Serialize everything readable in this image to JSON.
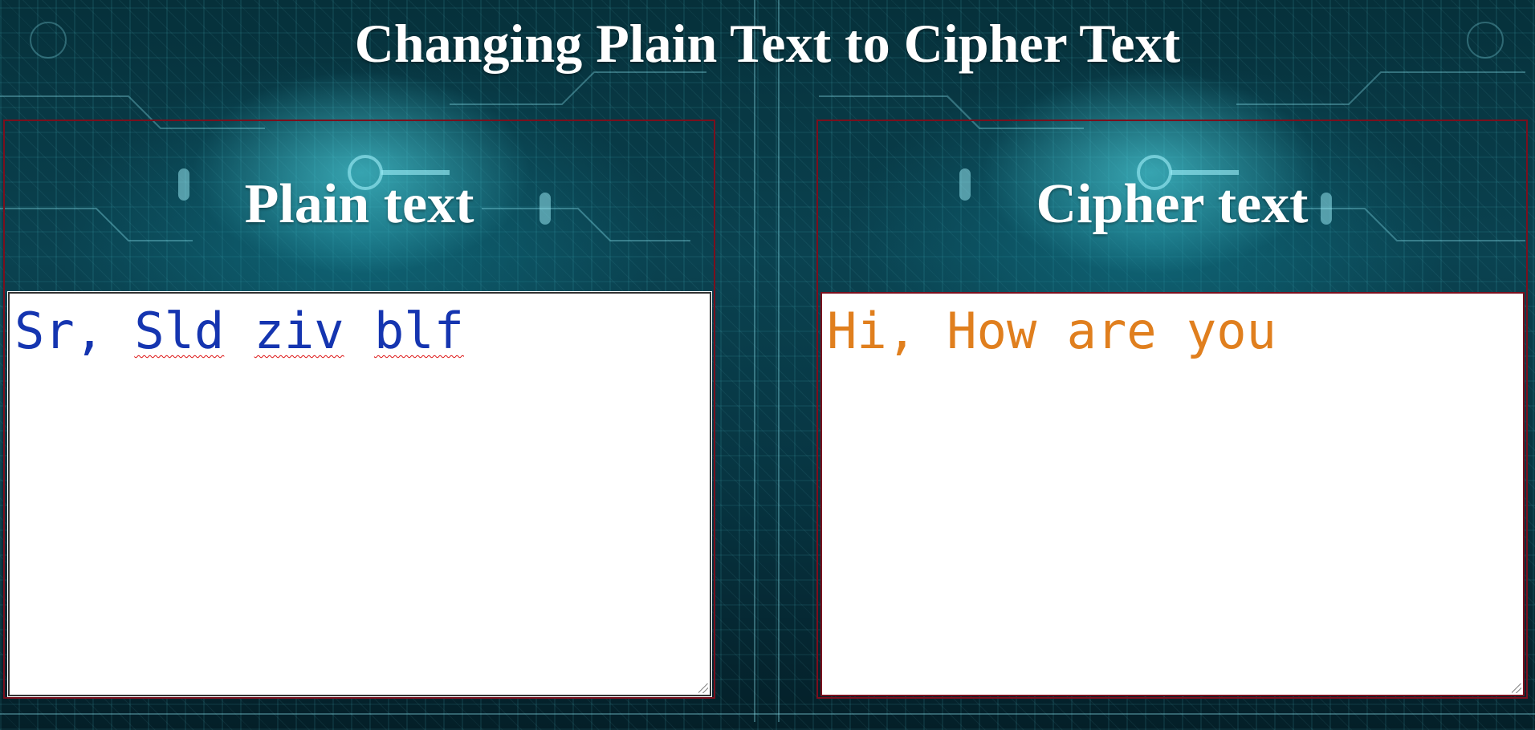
{
  "page": {
    "title": "Changing Plain Text to Cipher Text"
  },
  "plain_panel": {
    "heading": "Plain text",
    "text_parts": [
      "Sr, ",
      "Sld",
      " ",
      "ziv",
      " ",
      "blf"
    ],
    "text_color": "#1535b0"
  },
  "cipher_panel": {
    "heading": "Cipher text",
    "text": "Hi, How are you",
    "text_color": "#e07f1e"
  },
  "colors": {
    "panel_border": "#7a0f1d",
    "heading": "#ffffff",
    "background": "#0a4250"
  },
  "icons": {
    "background": "circuit-board-key-graphic",
    "resize": "resize-grip-icon"
  }
}
